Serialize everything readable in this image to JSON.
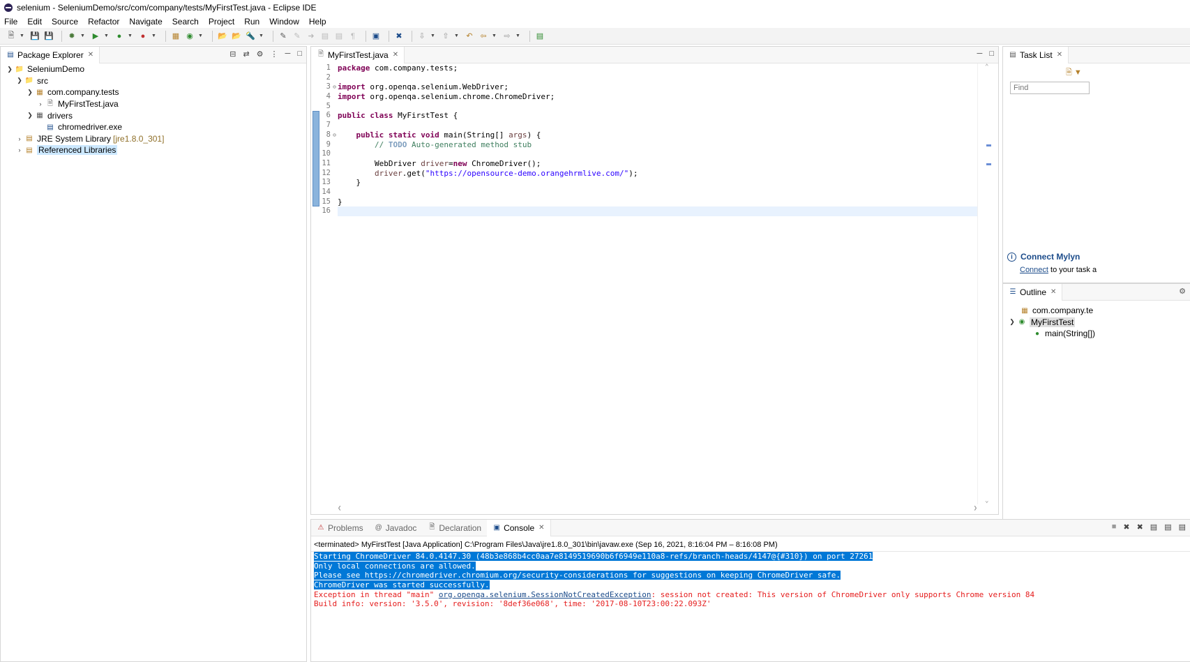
{
  "window": {
    "title": "selenium - SeleniumDemo/src/com/company/tests/MyFirstTest.java - Eclipse IDE"
  },
  "menu": [
    "File",
    "Edit",
    "Source",
    "Refactor",
    "Navigate",
    "Search",
    "Project",
    "Run",
    "Window",
    "Help"
  ],
  "package_explorer": {
    "tab_label": "Package Explorer",
    "tree": {
      "project": "SeleniumDemo",
      "src": "src",
      "package": "com.company.tests",
      "file": "MyFirstTest.java",
      "drivers": "drivers",
      "driver_file": "chromedriver.exe",
      "jre": "JRE System Library",
      "jre_version": "[jre1.8.0_301]",
      "ref_libs": "Referenced Libraries"
    }
  },
  "editor": {
    "tab_label": "MyFirstTest.java",
    "line_numbers": [
      "1",
      "2",
      "3",
      "4",
      "5",
      "6",
      "7",
      "8",
      "9",
      "10",
      "11",
      "12",
      "13",
      "14",
      "15",
      "16"
    ],
    "folds": {
      "3": "⊖",
      "8": "⊖"
    },
    "code": {
      "l1_kw": "package",
      "l1_rest": " com.company.tests;",
      "l3_kw": "import",
      "l3_rest": " org.openqa.selenium.WebDriver;",
      "l4_kw": "import",
      "l4_rest": " org.openqa.selenium.chrome.ChromeDriver;",
      "l6_kw": "public class",
      "l6_rest": " MyFirstTest {",
      "l8_indent": "    ",
      "l8_kw": "public static void",
      "l8_mid": " main(String[] ",
      "l8_var": "args",
      "l8_end": ") {",
      "l9_indent": "        ",
      "l9_pre": "// ",
      "l9_todo": "TODO",
      "l9_rest": " Auto-generated method stub",
      "l11_indent": "        ",
      "l11_pre": "WebDriver ",
      "l11_var": "driver",
      "l11_eq": "=",
      "l11_kw": "new",
      "l11_rest": " ChromeDriver();",
      "l12_indent": "        ",
      "l12_var": "driver",
      "l12_pre": ".get(",
      "l12_str": "\"https://opensource-demo.orangehrmlive.com/\"",
      "l12_end": ");",
      "l13": "    }",
      "l15": "}"
    }
  },
  "task_list": {
    "tab_label": "Task List",
    "find_placeholder": "Find",
    "mylyn_title": "Connect Mylyn",
    "mylyn_link": "Connect",
    "mylyn_text": " to your task a"
  },
  "outline": {
    "tab_label": "Outline",
    "items": [
      "com.company.te",
      "MyFirstTest",
      "main(String[])"
    ]
  },
  "console_tabs": {
    "problems": "Problems",
    "javadoc": "Javadoc",
    "declaration": "Declaration",
    "console": "Console"
  },
  "console": {
    "header": "<terminated> MyFirstTest [Java Application] C:\\Program Files\\Java\\jre1.8.0_301\\bin\\javaw.exe  (Sep 16, 2021, 8:16:04 PM – 8:16:08 PM)",
    "lines": [
      "Starting ChromeDriver 84.0.4147.30 (48b3e868b4cc0aa7e8149519690b6f6949e110a8-refs/branch-heads/4147@{#310}) on port 27261",
      "Only local connections are allowed.",
      "Please see https://chromedriver.chromium.org/security-considerations for suggestions on keeping ChromeDriver safe.",
      "ChromeDriver was started successfully."
    ],
    "exception_prefix": "Exception in thread \"main\" ",
    "exception_link": "org.openqa.selenium.SessionNotCreatedException",
    "exception_rest": ": session not created: This version of ChromeDriver only supports Chrome version 84",
    "build_info": "Build info: version: '3.5.0', revision: '8def36e068', time: '2017-08-10T23:00:22.093Z'"
  },
  "colors": {
    "selection": "#0078d7",
    "error": "#e51c1c",
    "keyword": "#7f0055",
    "string": "#2a00ff",
    "comment": "#3f7f5f"
  }
}
